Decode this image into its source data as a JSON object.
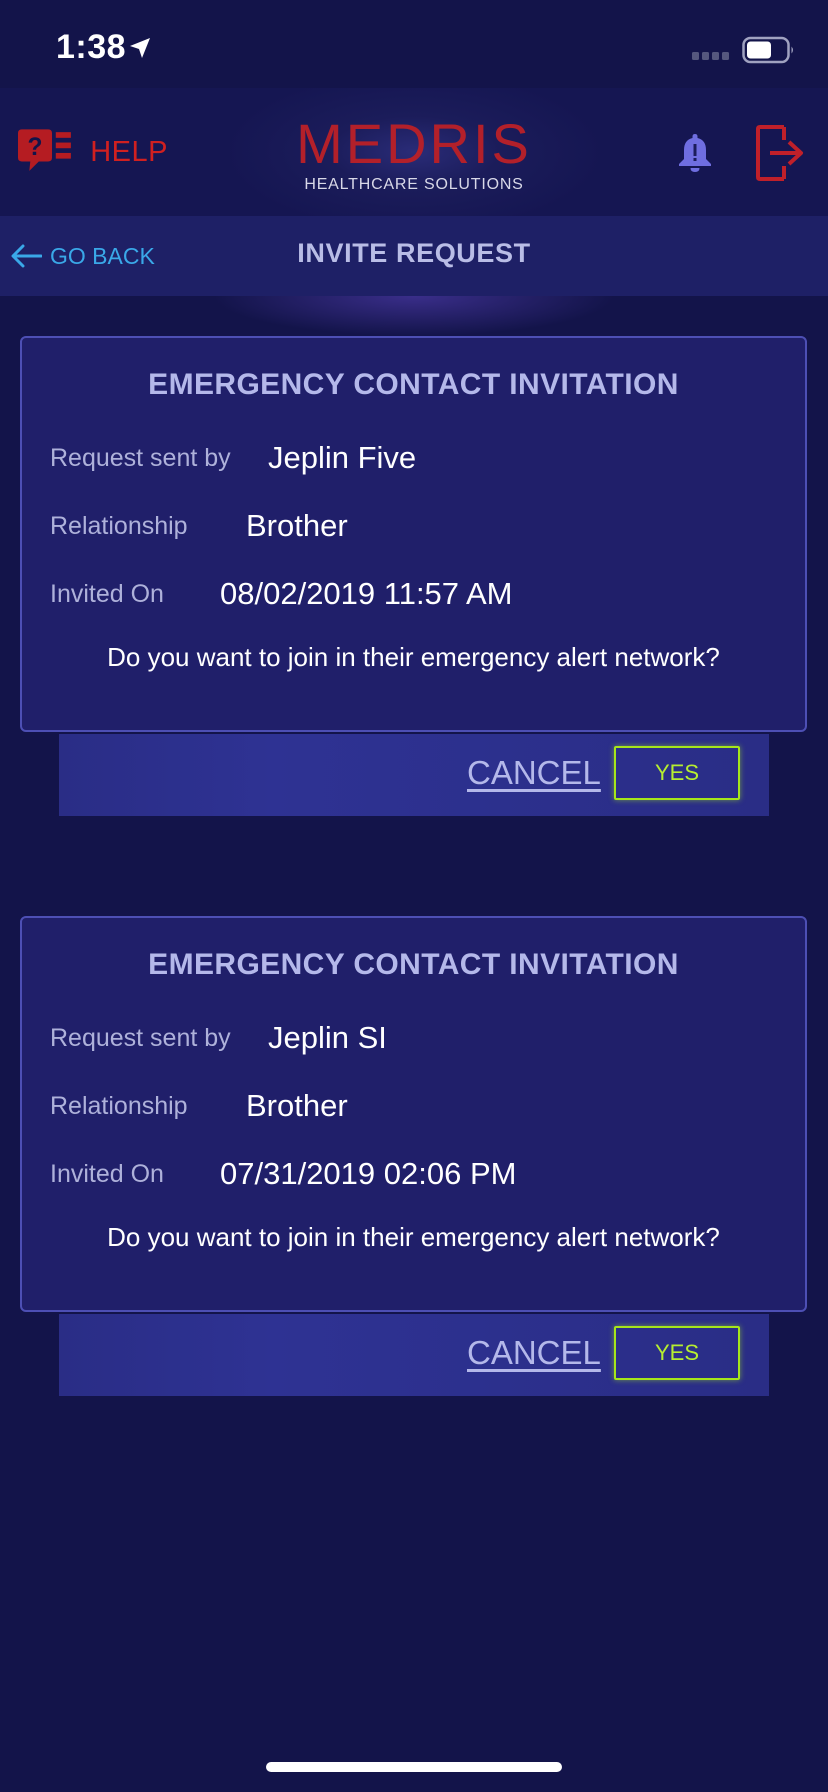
{
  "status_bar": {
    "time": "1:38",
    "icons": [
      "location-arrow-icon",
      "cellular-signal-icon",
      "battery-icon"
    ]
  },
  "header": {
    "help_label": "HELP",
    "brand_name": "MEDRIS",
    "brand_tagline": "HEALTHCARE SOLUTIONS",
    "icons": [
      "help-question-icon",
      "notification-bell-icon",
      "logout-icon"
    ]
  },
  "nav": {
    "back_label": "GO BACK",
    "title": "INVITE REQUEST"
  },
  "invitations": [
    {
      "title": "EMERGENCY CONTACT INVITATION",
      "sender_label": "Request sent by",
      "sender": "Jeplin Five",
      "relationship_label": "Relationship",
      "relationship": "Brother",
      "invited_label": "Invited On",
      "invited_on": "08/02/2019 11:57 AM",
      "question": "Do you want to join in their emergency alert network?",
      "cancel_label": "CANCEL",
      "yes_label": "YES"
    },
    {
      "title": "EMERGENCY CONTACT INVITATION",
      "sender_label": "Request sent by",
      "sender": "Jeplin SI",
      "relationship_label": "Relationship",
      "relationship": "Brother",
      "invited_label": "Invited On",
      "invited_on": "07/31/2019 02:06 PM",
      "question": "Do you want to join in their emergency alert network?",
      "cancel_label": "CANCEL",
      "yes_label": "YES"
    }
  ],
  "colors": {
    "background": "#13144a",
    "card": "#201f6a",
    "card_border": "#4d4fb4",
    "brand_red": "#b3202a",
    "help_red": "#d02020",
    "link_blue": "#3aa8e8",
    "yes_green": "#a6e61a",
    "muted_text": "#b4b8ea"
  }
}
